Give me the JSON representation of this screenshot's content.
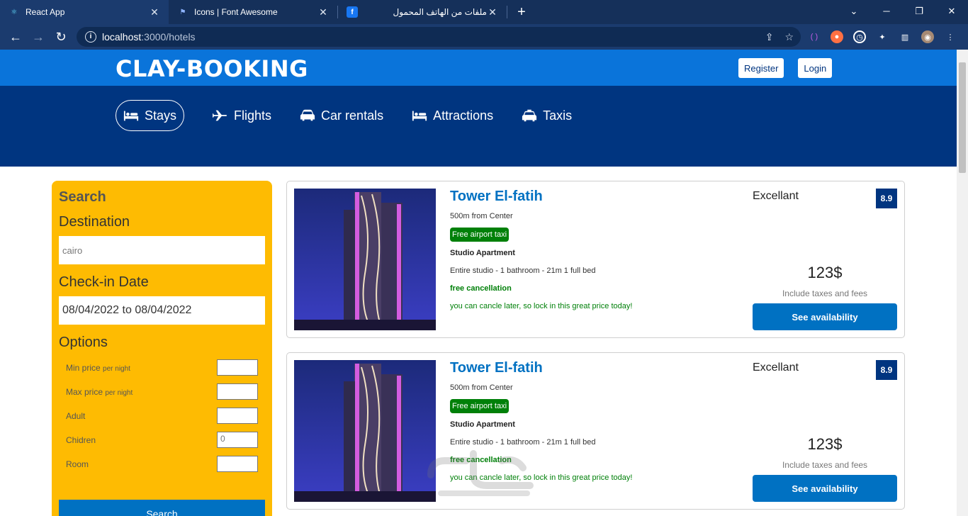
{
  "browser": {
    "tabs": [
      {
        "title": "React App",
        "active": true
      },
      {
        "title": "Icons | Font Awesome",
        "active": false
      },
      {
        "title": "ملفات من الهاتف المحمول",
        "active": false
      }
    ],
    "url_host": "localhost",
    "url_path": ":3000/hotels"
  },
  "site": {
    "logo": "CLAY-BOOKING",
    "register": "Register",
    "login": "Login"
  },
  "header": {
    "items": [
      {
        "label": "Stays",
        "icon": "bed-icon",
        "active": true
      },
      {
        "label": "Flights",
        "icon": "plane-icon",
        "active": false
      },
      {
        "label": "Car rentals",
        "icon": "car-icon",
        "active": false
      },
      {
        "label": "Attractions",
        "icon": "bed-icon",
        "active": false
      },
      {
        "label": "Taxis",
        "icon": "taxi-icon",
        "active": false
      }
    ]
  },
  "search": {
    "title": "Search",
    "destination_label": "Destination",
    "destination_value": "cairo",
    "checkin_label": "Check-in Date",
    "checkin_value": "08/04/2022 to 08/04/2022",
    "options_label": "Options",
    "options": [
      {
        "label": "Min price",
        "suffix": "per night",
        "value": ""
      },
      {
        "label": "Max price",
        "suffix": "per night",
        "value": ""
      },
      {
        "label": "Adult",
        "suffix": "",
        "value": ""
      },
      {
        "label": "Chidren",
        "suffix": "",
        "value": "0"
      },
      {
        "label": "Room",
        "suffix": "",
        "value": ""
      }
    ],
    "button": "Search"
  },
  "results": [
    {
      "name": "Tower El-fatih",
      "distance": "500m from Center",
      "taxi": "Free airport taxi",
      "subtitle": "Studio Apartment",
      "features": "Entire studio - 1 bathroom - 21m 1 full bed",
      "cancel": "free cancellation",
      "cancel_sub": "you can cancle later, so lock in this great price today!",
      "rating_text": "Excellant",
      "rating": "8.9",
      "price": "123$",
      "tax": "Include taxes and fees",
      "button": "See availability"
    },
    {
      "name": "Tower El-fatih",
      "distance": "500m from Center",
      "taxi": "Free airport taxi",
      "subtitle": "Studio Apartment",
      "features": "Entire studio - 1 bathroom - 21m 1 full bed",
      "cancel": "free cancellation",
      "cancel_sub": "you can cancle later, so lock in this great price today!",
      "rating_text": "Excellant",
      "rating": "8.9",
      "price": "123$",
      "tax": "Include taxes and fees",
      "button": "See availability"
    }
  ],
  "colors": {
    "brand_blue": "#0a74da",
    "header_blue": "#003580",
    "search_yellow": "#febb02",
    "action_blue": "#0071c2",
    "green": "#008009"
  }
}
